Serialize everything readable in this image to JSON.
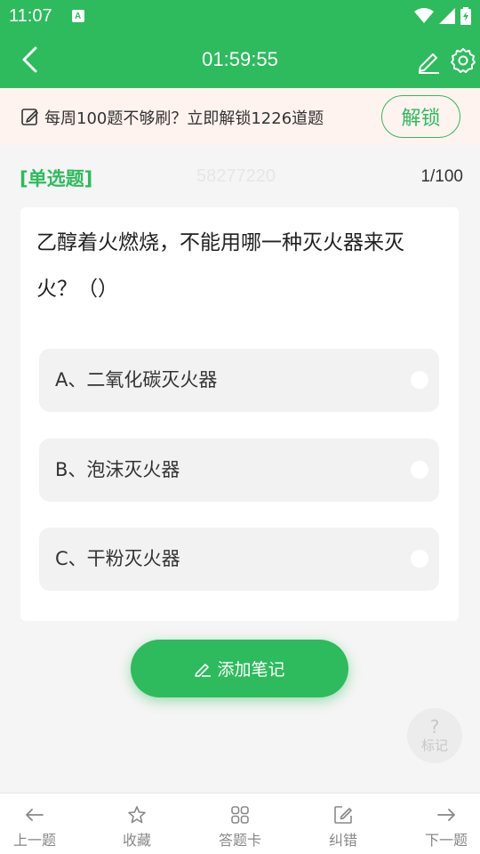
{
  "status_bar": {
    "time": "11:07",
    "app_icon": "A"
  },
  "header": {
    "title": "01:59:55"
  },
  "promo": {
    "text": "每周100题不够刷？立即解锁1226道题",
    "unlock_label": "解锁"
  },
  "question": {
    "type_label": "[单选题]",
    "watermark": "58277220",
    "progress": "1/100",
    "text": "乙醇着火燃烧，不能用哪一种灭火器来灭火？（）",
    "options": [
      {
        "label": "A、二氧化碳灭火器"
      },
      {
        "label": "B、泡沫灭火器"
      },
      {
        "label": "C、干粉灭火器"
      }
    ]
  },
  "add_note": {
    "label": "添加笔记"
  },
  "mark": {
    "symbol": "?",
    "label": "标记"
  },
  "bottom_nav": {
    "prev": "上一题",
    "favorite": "收藏",
    "answer_card": "答题卡",
    "report_error": "纠错",
    "next": "下一题"
  },
  "colors": {
    "primary": "#2dbb5d",
    "promo_bg": "#fff3ef",
    "page_bg": "#f5f5f5"
  },
  "icons": [
    "back-arrow-icon",
    "edit-icon",
    "gear-icon",
    "note-icon",
    "pen-icon",
    "question-mark-icon",
    "arrow-left-icon",
    "star-icon",
    "grid-icon",
    "edit-square-icon",
    "arrow-right-icon"
  ]
}
